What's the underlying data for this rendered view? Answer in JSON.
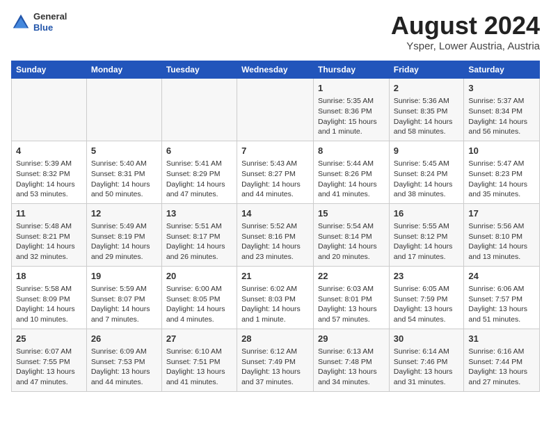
{
  "logo": {
    "general": "General",
    "blue": "Blue"
  },
  "title": "August 2024",
  "subtitle": "Ysper, Lower Austria, Austria",
  "headers": [
    "Sunday",
    "Monday",
    "Tuesday",
    "Wednesday",
    "Thursday",
    "Friday",
    "Saturday"
  ],
  "weeks": [
    [
      {
        "day": "",
        "content": ""
      },
      {
        "day": "",
        "content": ""
      },
      {
        "day": "",
        "content": ""
      },
      {
        "day": "",
        "content": ""
      },
      {
        "day": "1",
        "content": "Sunrise: 5:35 AM\nSunset: 8:36 PM\nDaylight: 15 hours and 1 minute."
      },
      {
        "day": "2",
        "content": "Sunrise: 5:36 AM\nSunset: 8:35 PM\nDaylight: 14 hours and 58 minutes."
      },
      {
        "day": "3",
        "content": "Sunrise: 5:37 AM\nSunset: 8:34 PM\nDaylight: 14 hours and 56 minutes."
      }
    ],
    [
      {
        "day": "4",
        "content": "Sunrise: 5:39 AM\nSunset: 8:32 PM\nDaylight: 14 hours and 53 minutes."
      },
      {
        "day": "5",
        "content": "Sunrise: 5:40 AM\nSunset: 8:31 PM\nDaylight: 14 hours and 50 minutes."
      },
      {
        "day": "6",
        "content": "Sunrise: 5:41 AM\nSunset: 8:29 PM\nDaylight: 14 hours and 47 minutes."
      },
      {
        "day": "7",
        "content": "Sunrise: 5:43 AM\nSunset: 8:27 PM\nDaylight: 14 hours and 44 minutes."
      },
      {
        "day": "8",
        "content": "Sunrise: 5:44 AM\nSunset: 8:26 PM\nDaylight: 14 hours and 41 minutes."
      },
      {
        "day": "9",
        "content": "Sunrise: 5:45 AM\nSunset: 8:24 PM\nDaylight: 14 hours and 38 minutes."
      },
      {
        "day": "10",
        "content": "Sunrise: 5:47 AM\nSunset: 8:23 PM\nDaylight: 14 hours and 35 minutes."
      }
    ],
    [
      {
        "day": "11",
        "content": "Sunrise: 5:48 AM\nSunset: 8:21 PM\nDaylight: 14 hours and 32 minutes."
      },
      {
        "day": "12",
        "content": "Sunrise: 5:49 AM\nSunset: 8:19 PM\nDaylight: 14 hours and 29 minutes."
      },
      {
        "day": "13",
        "content": "Sunrise: 5:51 AM\nSunset: 8:17 PM\nDaylight: 14 hours and 26 minutes."
      },
      {
        "day": "14",
        "content": "Sunrise: 5:52 AM\nSunset: 8:16 PM\nDaylight: 14 hours and 23 minutes."
      },
      {
        "day": "15",
        "content": "Sunrise: 5:54 AM\nSunset: 8:14 PM\nDaylight: 14 hours and 20 minutes."
      },
      {
        "day": "16",
        "content": "Sunrise: 5:55 AM\nSunset: 8:12 PM\nDaylight: 14 hours and 17 minutes."
      },
      {
        "day": "17",
        "content": "Sunrise: 5:56 AM\nSunset: 8:10 PM\nDaylight: 14 hours and 13 minutes."
      }
    ],
    [
      {
        "day": "18",
        "content": "Sunrise: 5:58 AM\nSunset: 8:09 PM\nDaylight: 14 hours and 10 minutes."
      },
      {
        "day": "19",
        "content": "Sunrise: 5:59 AM\nSunset: 8:07 PM\nDaylight: 14 hours and 7 minutes."
      },
      {
        "day": "20",
        "content": "Sunrise: 6:00 AM\nSunset: 8:05 PM\nDaylight: 14 hours and 4 minutes."
      },
      {
        "day": "21",
        "content": "Sunrise: 6:02 AM\nSunset: 8:03 PM\nDaylight: 14 hours and 1 minute."
      },
      {
        "day": "22",
        "content": "Sunrise: 6:03 AM\nSunset: 8:01 PM\nDaylight: 13 hours and 57 minutes."
      },
      {
        "day": "23",
        "content": "Sunrise: 6:05 AM\nSunset: 7:59 PM\nDaylight: 13 hours and 54 minutes."
      },
      {
        "day": "24",
        "content": "Sunrise: 6:06 AM\nSunset: 7:57 PM\nDaylight: 13 hours and 51 minutes."
      }
    ],
    [
      {
        "day": "25",
        "content": "Sunrise: 6:07 AM\nSunset: 7:55 PM\nDaylight: 13 hours and 47 minutes."
      },
      {
        "day": "26",
        "content": "Sunrise: 6:09 AM\nSunset: 7:53 PM\nDaylight: 13 hours and 44 minutes."
      },
      {
        "day": "27",
        "content": "Sunrise: 6:10 AM\nSunset: 7:51 PM\nDaylight: 13 hours and 41 minutes."
      },
      {
        "day": "28",
        "content": "Sunrise: 6:12 AM\nSunset: 7:49 PM\nDaylight: 13 hours and 37 minutes."
      },
      {
        "day": "29",
        "content": "Sunrise: 6:13 AM\nSunset: 7:48 PM\nDaylight: 13 hours and 34 minutes."
      },
      {
        "day": "30",
        "content": "Sunrise: 6:14 AM\nSunset: 7:46 PM\nDaylight: 13 hours and 31 minutes."
      },
      {
        "day": "31",
        "content": "Sunrise: 6:16 AM\nSunset: 7:44 PM\nDaylight: 13 hours and 27 minutes."
      }
    ]
  ]
}
